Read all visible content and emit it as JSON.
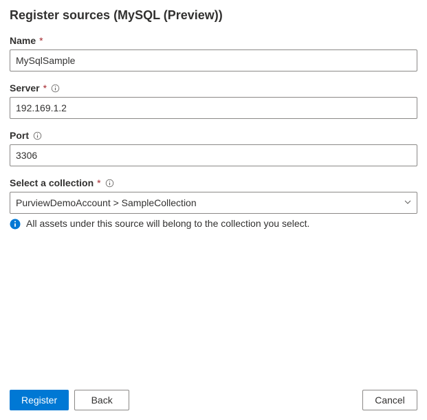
{
  "title": "Register sources (MySQL (Preview))",
  "fields": {
    "name": {
      "label": "Name",
      "required_marker": "*",
      "value": "MySqlSample"
    },
    "server": {
      "label": "Server",
      "required_marker": "*",
      "value": "192.169.1.2"
    },
    "port": {
      "label": "Port",
      "value": "3306"
    },
    "collection": {
      "label": "Select a collection",
      "required_marker": "*",
      "value": "PurviewDemoAccount > SampleCollection",
      "help_text": "All assets under this source will belong to the collection you select."
    }
  },
  "buttons": {
    "register": "Register",
    "back": "Back",
    "cancel": "Cancel"
  }
}
